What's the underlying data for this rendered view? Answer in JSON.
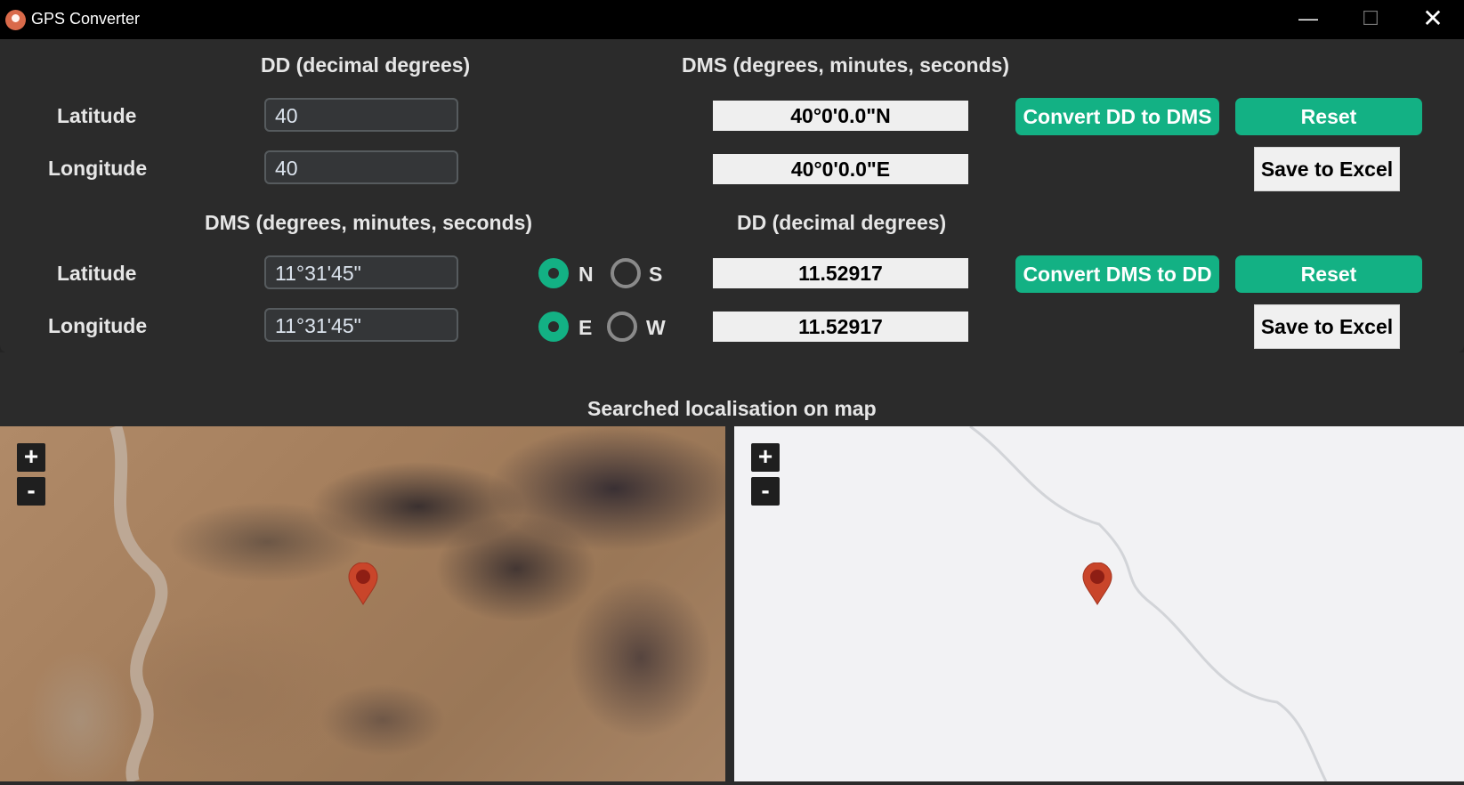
{
  "window": {
    "title": "GPS Converter",
    "minimize": "—",
    "maximize": "☐",
    "close": "✕"
  },
  "section1": {
    "dd_header": "DD (decimal degrees)",
    "dms_header": "DMS (degrees, minutes, seconds)",
    "lat_label": "Latitude",
    "lon_label": "Longitude",
    "lat_input": "40",
    "lon_input": "40",
    "lat_result": "40°0'0.0\"N",
    "lon_result": "40°0'0.0\"E",
    "convert_label": "Convert DD to DMS",
    "reset_label": "Reset",
    "save_label": "Save to Excel"
  },
  "section2": {
    "dms_header": "DMS (degrees, minutes, seconds)",
    "dd_header": "DD (decimal degrees)",
    "lat_label": "Latitude",
    "lon_label": "Longitude",
    "lat_input": "11°31'45\"",
    "lon_input": "11°31'45\"",
    "lat_dir_n": "N",
    "lat_dir_s": "S",
    "lon_dir_e": "E",
    "lon_dir_w": "W",
    "lat_selected": "N",
    "lon_selected": "E",
    "lat_result": "11.52917",
    "lon_result": "11.52917",
    "convert_label": "Convert DMS to DD",
    "reset_label": "Reset",
    "save_label": "Save to Excel"
  },
  "map_section": {
    "title": "Searched localisation on map",
    "zoom_in": "+",
    "zoom_out": "-",
    "pin_icon": "map-pin-icon"
  },
  "colors": {
    "accent": "#13b184",
    "pin": "#c9452a"
  }
}
